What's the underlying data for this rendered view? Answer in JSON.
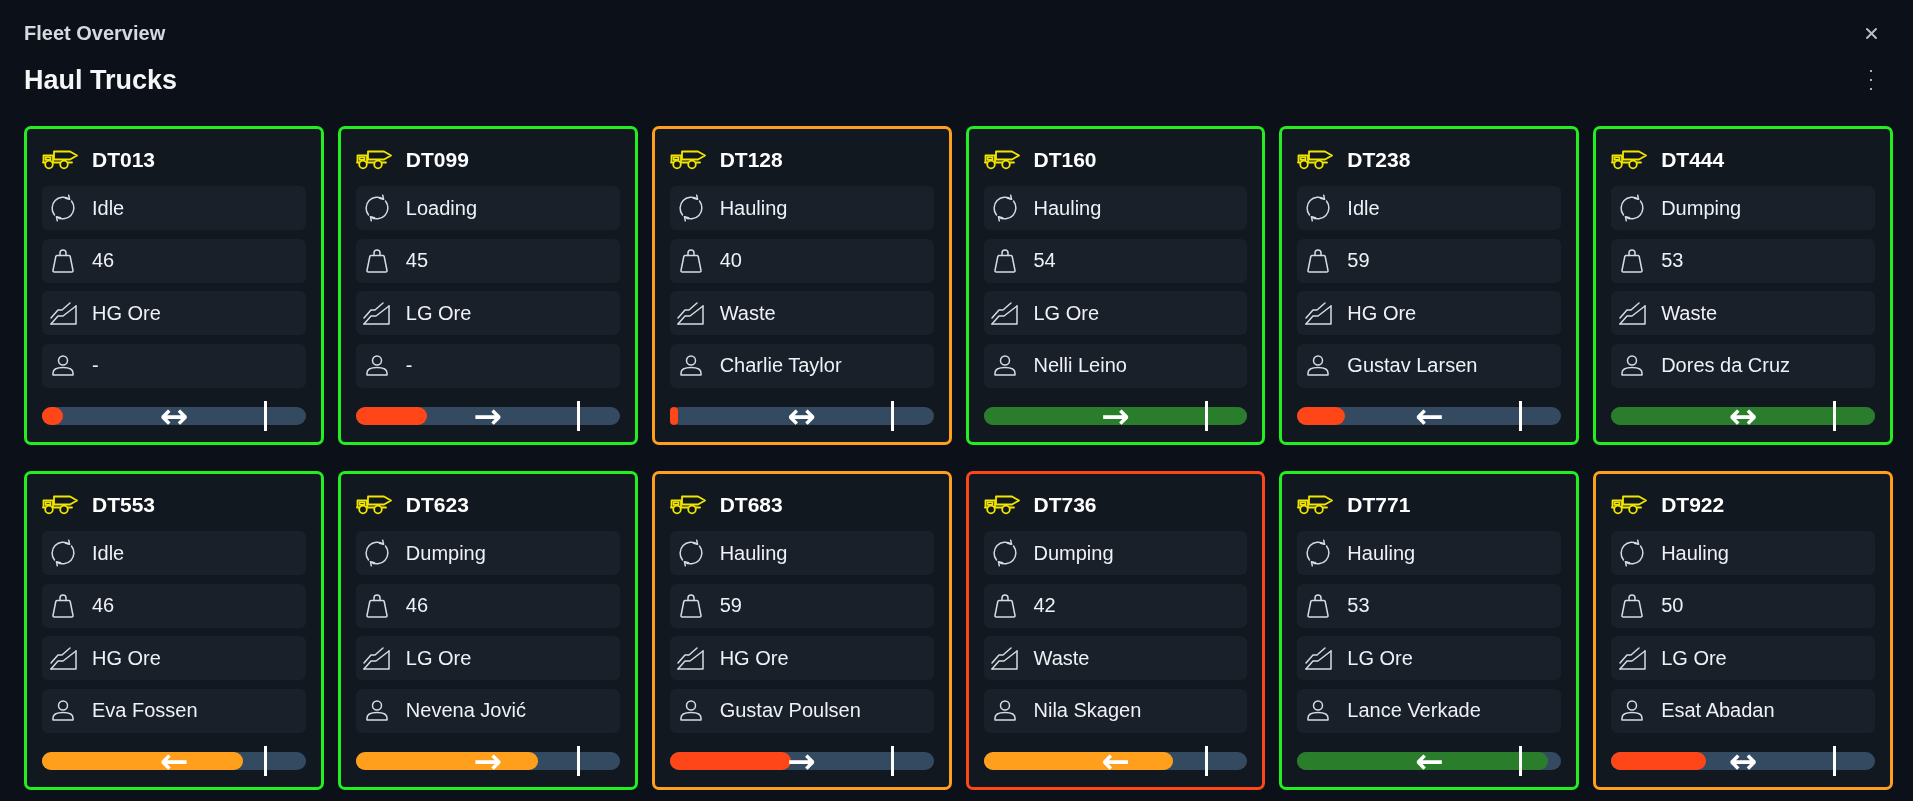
{
  "window": {
    "title": "Fleet Overview"
  },
  "heading": "Haul Trucks",
  "trucks": [
    {
      "id": "DT013",
      "color": "#22ee22",
      "state": "Idle",
      "payload": "46",
      "material": "HG Ore",
      "operator": "-",
      "progress": {
        "level": 0.08,
        "color": "#ff4619",
        "arrow": "↔"
      }
    },
    {
      "id": "DT099",
      "color": "#22ee22",
      "state": "Loading",
      "payload": "45",
      "material": "LG Ore",
      "operator": "-",
      "progress": {
        "level": 0.27,
        "color": "#ff4619",
        "arrow": "→"
      }
    },
    {
      "id": "DT128",
      "color": "#ff9f1c",
      "state": "Hauling",
      "payload": "40",
      "material": "Waste",
      "operator": "Charlie Taylor",
      "progress": {
        "level": 0.03,
        "color": "#ff4619",
        "arrow": "↔"
      }
    },
    {
      "id": "DT160",
      "color": "#22ee22",
      "state": "Hauling",
      "payload": "54",
      "material": "LG Ore",
      "operator": "Nelli Leino",
      "progress": {
        "level": 1,
        "color": "#2a7d2a",
        "arrow": "→"
      }
    },
    {
      "id": "DT238",
      "color": "#22ee22",
      "state": "Idle",
      "payload": "59",
      "material": "HG Ore",
      "operator": "Gustav Larsen",
      "progress": {
        "level": 0.18,
        "color": "#ff4619",
        "arrow": "←"
      }
    },
    {
      "id": "DT444",
      "color": "#22ee22",
      "state": "Dumping",
      "payload": "53",
      "material": "Waste",
      "operator": "Dores da Cruz",
      "progress": {
        "level": 1,
        "color": "#2a7d2a",
        "arrow": "↔"
      }
    },
    {
      "id": "DT553",
      "color": "#22ee22",
      "state": "Idle",
      "payload": "46",
      "material": "HG Ore",
      "operator": "Eva Fossen",
      "progress": {
        "level": 0.76,
        "color": "#ff9f1c",
        "arrow": "←"
      }
    },
    {
      "id": "DT623",
      "color": "#22ee22",
      "state": "Dumping",
      "payload": "46",
      "material": "LG Ore",
      "operator": "Nevena Jović",
      "progress": {
        "level": 0.69,
        "color": "#ff9f1c",
        "arrow": "→"
      }
    },
    {
      "id": "DT683",
      "color": "#ff9f1c",
      "state": "Hauling",
      "payload": "59",
      "material": "HG Ore",
      "operator": "Gustav Poulsen",
      "progress": {
        "level": 0.46,
        "color": "#ff4619",
        "arrow": "→"
      }
    },
    {
      "id": "DT736",
      "color": "#ff4619",
      "state": "Dumping",
      "payload": "42",
      "material": "Waste",
      "operator": "Nila Skagen",
      "progress": {
        "level": 0.72,
        "color": "#ff9f1c",
        "arrow": "←"
      }
    },
    {
      "id": "DT771",
      "color": "#22ee22",
      "state": "Hauling",
      "payload": "53",
      "material": "LG Ore",
      "operator": "Lance Verkade",
      "progress": {
        "level": 0.95,
        "color": "#2a7d2a",
        "arrow": "←"
      }
    },
    {
      "id": "DT922",
      "color": "#ff9f1c",
      "state": "Hauling",
      "payload": "50",
      "material": "LG Ore",
      "operator": "Esat Abadan",
      "progress": {
        "level": 0.36,
        "color": "#ff4619",
        "arrow": "↔"
      }
    }
  ]
}
